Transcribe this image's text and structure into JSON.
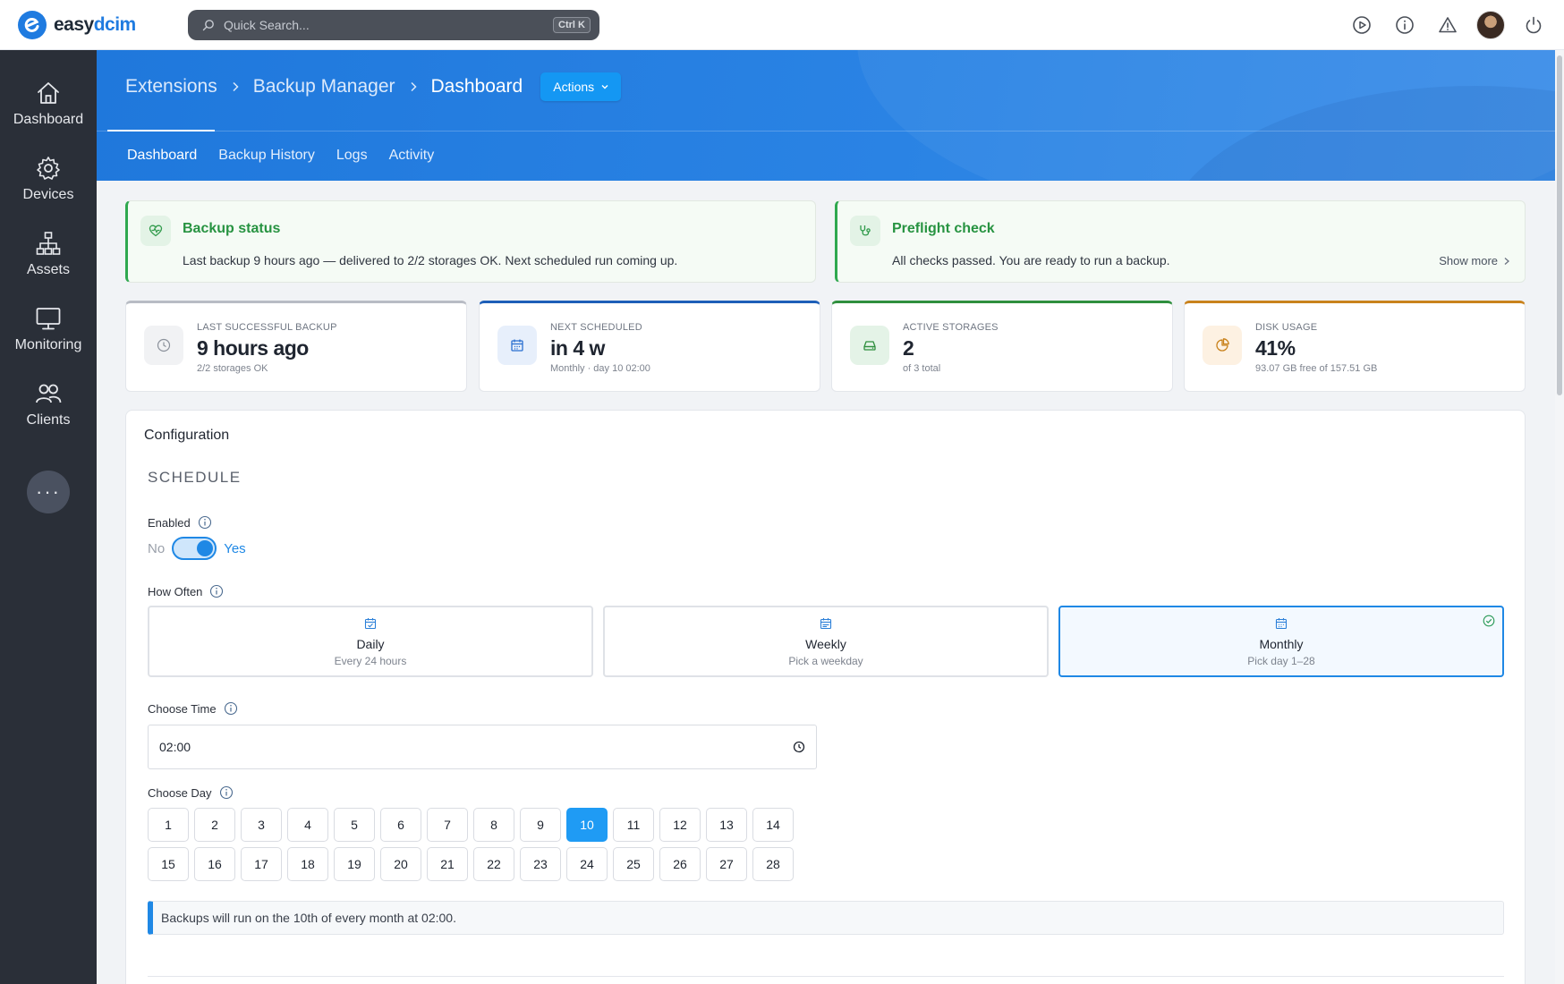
{
  "brand": {
    "part1": "easy",
    "part2": "dcim"
  },
  "search": {
    "placeholder": "Quick Search...",
    "shortcut": "Ctrl K"
  },
  "topbar": {
    "icons": [
      "play-circle-icon",
      "info-icon",
      "warning-icon",
      "avatar",
      "power-icon"
    ]
  },
  "sidebar": {
    "items": [
      {
        "label": "Dashboard",
        "icon": "home-icon"
      },
      {
        "label": "Devices",
        "icon": "gear-icon"
      },
      {
        "label": "Assets",
        "icon": "sitemap-icon"
      },
      {
        "label": "Monitoring",
        "icon": "monitor-icon"
      },
      {
        "label": "Clients",
        "icon": "users-icon"
      }
    ],
    "more_label": "···"
  },
  "breadcrumbs": [
    "Extensions",
    "Backup Manager",
    "Dashboard"
  ],
  "actions_label": "Actions",
  "tabs": [
    {
      "label": "Dashboard",
      "active": true
    },
    {
      "label": "Backup History",
      "active": false
    },
    {
      "label": "Logs",
      "active": false
    },
    {
      "label": "Activity",
      "active": false
    }
  ],
  "status_cards": [
    {
      "title": "Backup status",
      "text": "Last backup 9 hours ago — delivered to 2/2 storages OK. Next scheduled run coming up.",
      "icon": "heart-pulse-icon"
    },
    {
      "title": "Preflight check",
      "text": "All checks passed. You are ready to run a backup.",
      "icon": "stethoscope-icon",
      "link": "Show more"
    }
  ],
  "stats": [
    {
      "label": "Last Successful Backup",
      "value": "9 hours ago",
      "sub": "2/2 storages OK",
      "icon": "clock-icon",
      "accent": "#b8bcc4"
    },
    {
      "label": "Next Scheduled",
      "value": "in 4 w",
      "sub": "Monthly · day 10 02:00",
      "icon": "calendar-icon",
      "accent": "#1e5fb8"
    },
    {
      "label": "Active Storages",
      "value": "2",
      "sub": "of 3 total",
      "icon": "hard-drive-icon",
      "accent": "#2f8f3e"
    },
    {
      "label": "Disk Usage",
      "value": "41%",
      "sub": "93.07 GB free of 157.51 GB",
      "icon": "pie-chart-icon",
      "accent": "#c9821c"
    }
  ],
  "config": {
    "title": "Configuration",
    "section": "SCHEDULE",
    "enabled_label": "Enabled",
    "toggle": {
      "no": "No",
      "yes": "Yes",
      "on": true
    },
    "how_often_label": "How Often",
    "frequencies": [
      {
        "title": "Daily",
        "sub": "Every 24 hours",
        "selected": false
      },
      {
        "title": "Weekly",
        "sub": "Pick a weekday",
        "selected": false
      },
      {
        "title": "Monthly",
        "sub": "Pick day 1–28",
        "selected": true
      }
    ],
    "time_label": "Choose Time",
    "time_value": "02:00",
    "day_label": "Choose Day",
    "days": [
      "1",
      "2",
      "3",
      "4",
      "5",
      "6",
      "7",
      "8",
      "9",
      "10",
      "11",
      "12",
      "13",
      "14",
      "15",
      "16",
      "17",
      "18",
      "19",
      "20",
      "21",
      "22",
      "23",
      "24",
      "25",
      "26",
      "27",
      "28"
    ],
    "selected_day": "10",
    "summary": "Backups will run on the 10th of every month at 02:00."
  },
  "colors": {
    "primary": "#1f88e5",
    "sidebar": "#2a2f38",
    "success": "#2fa84f"
  }
}
